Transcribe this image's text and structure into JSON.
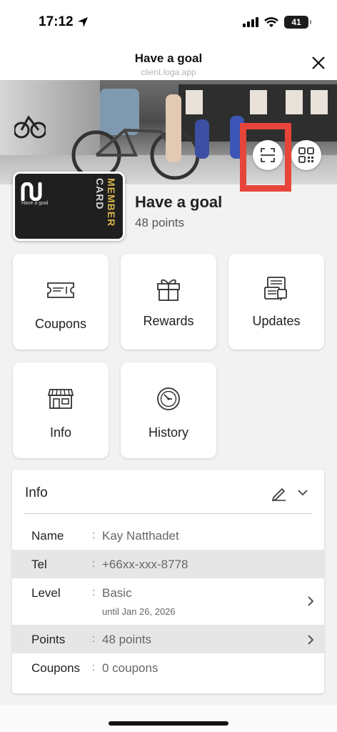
{
  "status_bar": {
    "time": "17:12",
    "battery": "41"
  },
  "header": {
    "title": "Have a goal",
    "subtitle": "client.loga.app"
  },
  "member_card": {
    "logo_text": "Have a goal",
    "label_top": "MEMBER",
    "label_bottom": "CARD"
  },
  "profile": {
    "name": "Have a goal",
    "points": "48 points"
  },
  "tiles": [
    {
      "label": "Coupons",
      "icon": "ticket-icon"
    },
    {
      "label": "Rewards",
      "icon": "gift-icon"
    },
    {
      "label": "Updates",
      "icon": "news-icon"
    },
    {
      "label": "Info",
      "icon": "store-icon"
    },
    {
      "label": "History",
      "icon": "clock-icon"
    }
  ],
  "info": {
    "title": "Info",
    "rows": [
      {
        "label": "Name",
        "colon": ":",
        "value": "Kay Natthadet"
      },
      {
        "label": "Tel",
        "colon": ":",
        "value": "+66xx-xxx-8778"
      },
      {
        "label": "Level",
        "colon": ":",
        "value": "Basic",
        "sub": "until Jan 26, 2026"
      },
      {
        "label": "Points",
        "colon": ":",
        "value": "48 points"
      },
      {
        "label": "Coupons",
        "colon": ":",
        "value": "0 coupons"
      }
    ]
  },
  "colors": {
    "highlight": "#e8453a",
    "card_gold": "#d7b44a"
  }
}
